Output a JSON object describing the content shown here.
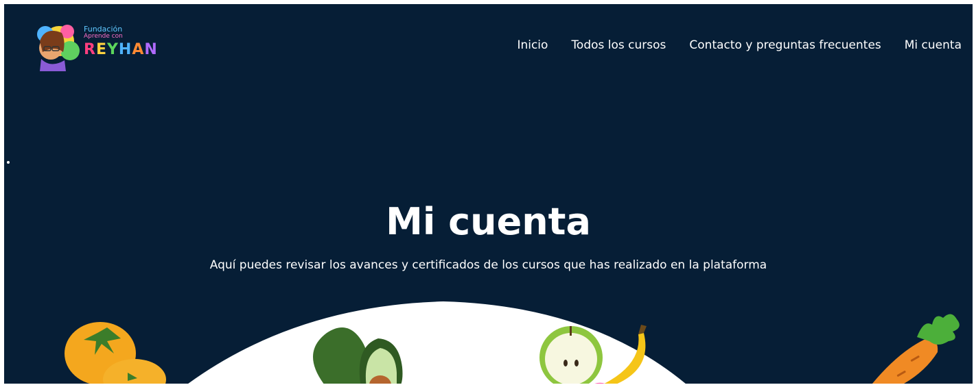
{
  "brand": {
    "line1": "Fundación",
    "line2": "Aprende con",
    "name": "REYHAN",
    "letters": [
      "R",
      "E",
      "Y",
      "H",
      "A",
      "N"
    ]
  },
  "nav": {
    "items": [
      {
        "label": "Inicio"
      },
      {
        "label": "Todos los cursos"
      },
      {
        "label": "Contacto y preguntas frecuentes"
      },
      {
        "label": "Mi cuenta"
      }
    ]
  },
  "hero": {
    "title": "Mi cuenta",
    "subtitle": "Aquí puedes revisar los avances y certificados de los cursos que has realizado en la plataforma"
  },
  "colors": {
    "background": "#061e36",
    "text": "#ffffff"
  },
  "illustrations": [
    "oranges-icon",
    "avocado-icon",
    "apple-icon",
    "banana-icon",
    "carrot-icon"
  ]
}
